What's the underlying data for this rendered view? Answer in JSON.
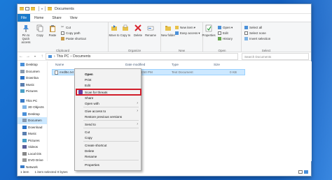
{
  "window": {
    "title": "Documents",
    "quick_access_sep": "│ ▾ │"
  },
  "menu": {
    "file": "File",
    "tabs": [
      "Home",
      "Share",
      "View"
    ]
  },
  "ribbon": {
    "clipboard": {
      "label": "Clipboard",
      "pin": "Pin to Quick access",
      "copy": "Copy",
      "paste": "Paste",
      "cut": "Cut",
      "copy_path": "Copy path",
      "paste_shortcut": "Paste shortcut"
    },
    "organize": {
      "label": "Organize",
      "move_to": "Move to",
      "copy_to": "Copy to",
      "delete": "Delete",
      "rename": "Rename"
    },
    "new": {
      "label": "New",
      "new_folder": "New folder",
      "new_item": "New item",
      "easy_access": "Easy access"
    },
    "open": {
      "label": "Open",
      "properties": "Properties",
      "open": "Open",
      "edit": "Edit",
      "history": "History"
    },
    "select": {
      "label": "Select",
      "select_all": "Select all",
      "select_none": "Select none",
      "invert_selection": "Invert selection"
    }
  },
  "address": {
    "path": [
      "This PC",
      "Documents"
    ],
    "search_placeholder": "Search Documents"
  },
  "nav": {
    "items": [
      {
        "label": "Desktop",
        "icon": "desktop-icon"
      },
      {
        "label": "Documen",
        "icon": "documents-icon"
      },
      {
        "label": "Downloa",
        "icon": "downloads-icon"
      },
      {
        "label": "Music",
        "icon": "music-icon"
      },
      {
        "label": "Pictures",
        "icon": "pictures-icon"
      },
      {
        "label": "This PC",
        "icon": "pc-icon"
      },
      {
        "label": "3D Objects",
        "icon": "cube-icon"
      },
      {
        "label": "Desktop",
        "icon": "desktop-icon"
      },
      {
        "label": "Documen",
        "icon": "documents-icon"
      },
      {
        "label": "Download",
        "icon": "downloads-icon"
      },
      {
        "label": "Music",
        "icon": "music-icon"
      },
      {
        "label": "Pictures",
        "icon": "pictures-icon"
      },
      {
        "label": "Videos",
        "icon": "videos-icon"
      },
      {
        "label": "Local Dis",
        "icon": "drive-icon"
      },
      {
        "label": "DVD Drive",
        "icon": "dvd-icon"
      },
      {
        "label": "Network",
        "icon": "network-icon"
      }
    ],
    "selected_index": 8
  },
  "columns": [
    "Name",
    "Date modified",
    "Type",
    "Size"
  ],
  "file": {
    "name": "mrdl5c.txt",
    "date": "7/18/2019 8:50 PM",
    "type": "Text Document",
    "size": "0 KB"
  },
  "status": {
    "items": "1 item",
    "selected": "1 item selected 0 bytes"
  },
  "context_menu": {
    "items": [
      {
        "label": "Open",
        "bold": true
      },
      {
        "label": "Print"
      },
      {
        "label": "Edit"
      },
      {
        "label": "Scan for threats",
        "highlighted": true
      },
      {
        "label": "Share"
      },
      {
        "label": "Open with",
        "submenu": true
      },
      {
        "label": "Give access to",
        "submenu": true
      },
      {
        "label": "Restore previous versions"
      },
      {
        "label": "Send to",
        "submenu": true
      },
      {
        "label": "Cut"
      },
      {
        "label": "Copy"
      },
      {
        "label": "Create shortcut"
      },
      {
        "label": "Delete"
      },
      {
        "label": "Rename"
      },
      {
        "label": "Properties"
      }
    ]
  },
  "colors": {
    "accent": "#1979ca",
    "selection": "#cce8ff",
    "highlight_border": "#d11d2a"
  }
}
